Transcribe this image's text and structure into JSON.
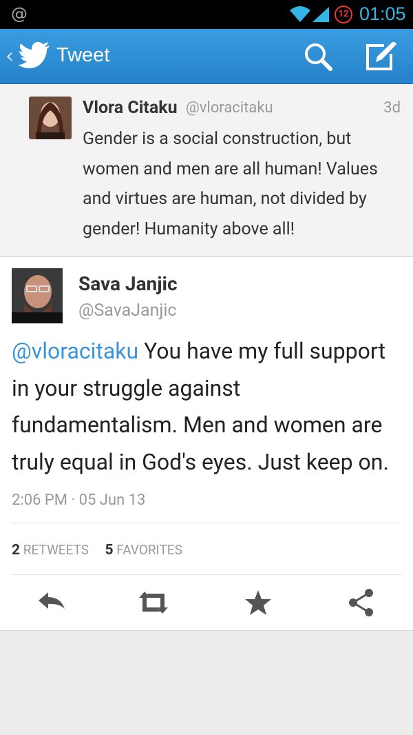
{
  "status_bar": {
    "left_icon": "@",
    "notification_count": "12",
    "time": "01:05"
  },
  "action_bar": {
    "back_icon": "‹",
    "title": "Tweet"
  },
  "parent_tweet": {
    "name": "Vlora Citaku",
    "handle": "@vloracitaku",
    "time": "3d",
    "text": "Gender is a social construction, but women and men are all human! Values and virtues are human, not divided by gender! Humanity above all!"
  },
  "main_tweet": {
    "name": "Sava Janjic",
    "handle": "@SavaJanjic",
    "mention": "@vloracitaku",
    "text": " You have my full support in your struggle against fundamentalism. Men and  women are truly equal in God's eyes. Just keep on.",
    "timestamp": "2:06 PM · 05 Jun 13",
    "retweets_count": "2",
    "retweets_label": "RETWEETS",
    "favorites_count": "5",
    "favorites_label": "FAVORITES"
  },
  "colors": {
    "action_bar": "#2b8ad3",
    "mention": "#3b94d9",
    "status_accent": "#33b5e5"
  }
}
